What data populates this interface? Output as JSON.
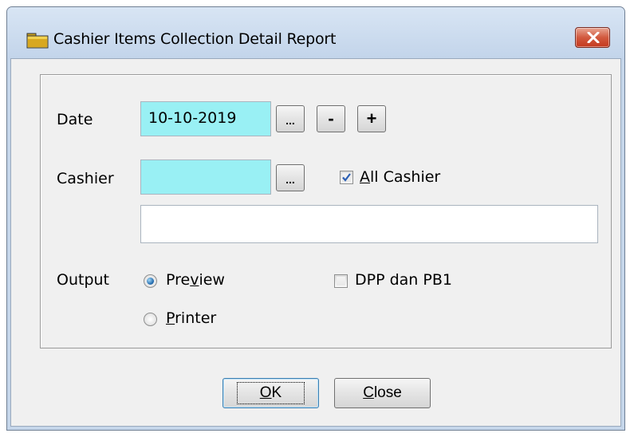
{
  "window": {
    "title": "Cashier Items Collection Detail Report",
    "title_icon": "folder-icon",
    "close_icon": "close-icon"
  },
  "form": {
    "date_label": "Date",
    "date_value": "10-10-2019",
    "date_browse_label": "...",
    "date_minus_label": "-",
    "date_plus_label": "+",
    "cashier_label": "Cashier",
    "cashier_value": "",
    "cashier_browse_label": "...",
    "all_cashier": {
      "checked": true,
      "mnemonic": "A",
      "rest": "ll Cashier"
    },
    "cashier_name_value": "",
    "output_label": "Output",
    "output_options": [
      {
        "pre": "Pre",
        "mnemonic": "v",
        "post": "iew",
        "selected": true
      },
      {
        "pre": "",
        "mnemonic": "P",
        "post": "rinter",
        "selected": false
      }
    ],
    "dpp": {
      "checked": false,
      "label": "DPP dan PB1"
    }
  },
  "buttons": {
    "ok": {
      "mnemonic": "O",
      "rest": "K"
    },
    "close": {
      "mnemonic": "C",
      "rest": "lose"
    }
  },
  "colors": {
    "input_highlight": "#99f0f4",
    "title_bar": "#c5d6ea",
    "close_button": "#d2593e",
    "check_mark": "#2b5fb4"
  }
}
